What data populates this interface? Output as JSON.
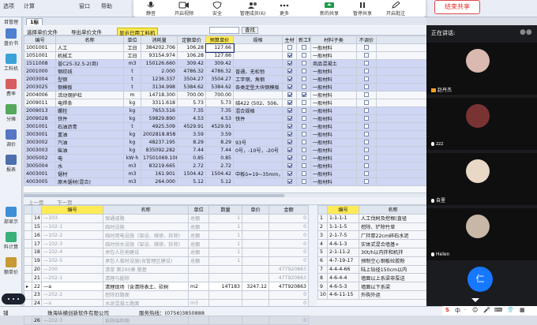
{
  "app_menu": [
    "选项",
    "计算",
    "窗口",
    "帮助"
  ],
  "meeting_toolbar": {
    "buttons": [
      {
        "label": "静音",
        "icon": "mic-icon"
      },
      {
        "label": "开启视频",
        "icon": "video-icon"
      },
      {
        "label": "安全",
        "icon": "shield-icon"
      },
      {
        "label": "管理成员(6)",
        "icon": "members-icon"
      },
      {
        "label": "更多",
        "icon": "more-icon"
      },
      {
        "label": "新的共享",
        "icon": "share-icon"
      },
      {
        "label": "暂停共享",
        "icon": "pause-icon"
      },
      {
        "label": "开启批注",
        "icon": "annotate-icon"
      }
    ],
    "end_share": "结束共享"
  },
  "sidebar": {
    "items": [
      {
        "label": "目管理",
        "icon": "project-icon"
      },
      {
        "label": "盘价书",
        "icon": "book-icon"
      },
      {
        "label": "工料机",
        "icon": "labor-icon"
      },
      {
        "label": "费率",
        "icon": "rate-icon"
      },
      {
        "label": "分摊",
        "icon": "split-icon"
      },
      {
        "label": "调价",
        "icon": "price-icon"
      },
      {
        "label": "报表",
        "icon": "report-icon"
      },
      {
        "label": "部显示",
        "icon": "display-icon"
      },
      {
        "label": "料计算",
        "icon": "calc-icon"
      },
      {
        "label": "额单价",
        "icon": "unit-price-icon"
      }
    ]
  },
  "main": {
    "tab": "1标",
    "toolbar": {
      "select_unit": "选择单价文件",
      "export_unit": "导出单价文件",
      "filter": "显示已用工料机",
      "search": "查找"
    },
    "upper_columns": [
      "编号",
      "名称",
      "单位",
      "消耗量",
      "定额单价",
      "预算单价",
      "规格",
      "主材",
      "新工料",
      "材料子类",
      "不调价"
    ],
    "upper_rows": [
      {
        "code": "1001001",
        "name": "人工",
        "unit": "工日",
        "qty": "384202.706",
        "quota": "106.28",
        "budget": "127.66",
        "spec": "",
        "main": false,
        "newm": false,
        "sub": "一般材料",
        "nadj": false,
        "sel": false
      },
      {
        "code": "1051001",
        "name": "机械工",
        "unit": "工日",
        "qty": "93154.974",
        "quota": "106.28",
        "budget": "127.66",
        "spec": "",
        "main": true,
        "newm": false,
        "sub": "一般材料",
        "nadj": false,
        "sel": false
      },
      {
        "code": "1511008",
        "name": "普C25-32.5-2(商)",
        "unit": "m3",
        "qty": "150126.660",
        "quota": "309.42",
        "budget": "309.42",
        "spec": "",
        "main": true,
        "newm": false,
        "sub": "商品混凝土",
        "nadj": false,
        "sel": true
      },
      {
        "code": "2001000",
        "name": "钢绞线",
        "unit": "t",
        "qty": "2.000",
        "quota": "4786.32",
        "budget": "4786.32",
        "spec": "普通，无松弛",
        "main": true,
        "newm": false,
        "sub": "一般材料",
        "nadj": false,
        "sel": true
      },
      {
        "code": "2003004",
        "name": "型钢",
        "unit": "t",
        "qty": "1236.337",
        "quota": "3504.27",
        "budget": "3504.27",
        "spec": "工字钢，角钢",
        "main": true,
        "newm": false,
        "sub": "一般材料",
        "nadj": false,
        "sel": true
      },
      {
        "code": "2003025",
        "name": "钢模板",
        "unit": "t",
        "qty": "3134.998",
        "quota": "5384.62",
        "budget": "5384.62",
        "spec": "各类定型大块钢模板",
        "main": true,
        "newm": false,
        "sub": "一般材料",
        "nadj": false,
        "sel": true
      },
      {
        "code": "2004006",
        "name": "活动钢护栏",
        "unit": "m",
        "qty": "14718.300",
        "quota": "700.00",
        "budget": "700.00",
        "spec": "",
        "main": true,
        "newm": true,
        "sub": "一般材料",
        "nadj": false,
        "sel": false
      },
      {
        "code": "2009011",
        "name": "电焊条",
        "unit": "kg",
        "qty": "3311.618",
        "quota": "5.73",
        "budget": "5.73",
        "spec": "结422 (502、506、5",
        "main": true,
        "newm": false,
        "sub": "一般材料",
        "nadj": false,
        "sel": false
      },
      {
        "code": "2009013",
        "name": "螺栓",
        "unit": "kg",
        "qty": "7653.516",
        "quota": "7.35",
        "budget": "7.35",
        "spec": "混合规格",
        "main": true,
        "newm": false,
        "sub": "一般材料",
        "nadj": false,
        "sel": true
      },
      {
        "code": "2009028",
        "name": "铁件",
        "unit": "kg",
        "qty": "59829.890",
        "quota": "4.53",
        "budget": "4.53",
        "spec": "铁件",
        "main": true,
        "newm": false,
        "sub": "一般材料",
        "nadj": false,
        "sel": true
      },
      {
        "code": "3001001",
        "name": "石油沥青",
        "unit": "t",
        "qty": "4925.509",
        "quota": "4529.91",
        "budget": "4529.91",
        "spec": "",
        "main": true,
        "newm": false,
        "sub": "一般材料",
        "nadj": false,
        "sel": true
      },
      {
        "code": "3003001",
        "name": "重油",
        "unit": "kg",
        "qty": "2002818.858",
        "quota": "3.59",
        "budget": "3.59",
        "spec": "",
        "main": true,
        "newm": false,
        "sub": "一般材料",
        "nadj": false,
        "sel": true
      },
      {
        "code": "3003002",
        "name": "汽油",
        "unit": "kg",
        "qty": "48237.195",
        "quota": "8.29",
        "budget": "8.29",
        "spec": "93号",
        "main": true,
        "newm": false,
        "sub": "一般材料",
        "nadj": false,
        "sel": true
      },
      {
        "code": "3003003",
        "name": "柴油",
        "unit": "kg",
        "qty": "835092.282",
        "quota": "7.44",
        "budget": "7.44",
        "spec": "0号，-10号，-20号",
        "main": true,
        "newm": false,
        "sub": "一般材料",
        "nadj": false,
        "sel": true
      },
      {
        "code": "3005002",
        "name": "电",
        "unit": "kW·h",
        "qty": "17501069.108",
        "quota": "0.85",
        "budget": "0.85",
        "spec": "",
        "main": true,
        "newm": false,
        "sub": "一般材料",
        "nadj": false,
        "sel": true
      },
      {
        "code": "3005004",
        "name": "水",
        "unit": "m3",
        "qty": "83219.665",
        "quota": "2.72",
        "budget": "2.72",
        "spec": "",
        "main": true,
        "newm": false,
        "sub": "一般材料",
        "nadj": false,
        "sel": true
      },
      {
        "code": "4003001",
        "name": "锯材",
        "unit": "m3",
        "qty": "161.901",
        "quota": "1504.42",
        "budget": "1504.42",
        "spec": "中板δ=19~35mm，",
        "main": true,
        "newm": false,
        "sub": "一般材料",
        "nadj": false,
        "sel": true
      },
      {
        "code": "4003005",
        "name": "原木锯材(混合)",
        "unit": "m3",
        "qty": "264.000",
        "quota": "5.12",
        "budget": "5.12",
        "spec": "",
        "main": true,
        "newm": false,
        "sub": "一般材料",
        "nadj": false,
        "sel": true
      }
    ],
    "lower_nav": [
      "上一页",
      "下一页"
    ],
    "lower_left_columns": [
      "",
      "编号",
      "名称",
      "单位",
      "数量",
      "单价",
      "金额"
    ],
    "lower_left_rows": [
      {
        "no": "14",
        "code": "—103",
        "name": "保通道路",
        "unit": "总额",
        "qty": "1",
        "price": "",
        "amount": "0",
        "grey": true
      },
      {
        "no": "15",
        "code": "—102-1",
        "name": "临时设施",
        "unit": "总额",
        "qty": "1",
        "price": "",
        "amount": "0",
        "grey": true
      },
      {
        "no": "16",
        "code": "—102-2",
        "name": "临时用电设施（架设、维修、拆除）",
        "unit": "总额",
        "qty": "1",
        "price": "",
        "amount": "0",
        "grey": true
      },
      {
        "no": "17",
        "code": "—102-3",
        "name": "临时供水设施（架设、维修、拆除）",
        "unit": "总额",
        "qty": "1",
        "price": "",
        "amount": "0",
        "grey": true
      },
      {
        "no": "18",
        "code": "—102-4",
        "name": "承包人驻地建设",
        "unit": "总额",
        "qty": "1",
        "price": "",
        "amount": "0",
        "grey": true
      },
      {
        "no": "19",
        "code": "—102-5",
        "name": "承包人临时设施(含管理区建设)",
        "unit": "总额",
        "qty": "1",
        "price": "",
        "amount": "0",
        "grey": true
      },
      {
        "no": "20",
        "code": "—200",
        "name": "清单 第200章 路基",
        "unit": "",
        "qty": "",
        "price": "",
        "amount": "47T920863",
        "grey": true
      },
      {
        "no": "21",
        "code": "—202-1",
        "name": "清理与掘除",
        "unit": "",
        "qty": "",
        "price": "",
        "amount": "47T920863",
        "grey": true
      },
      {
        "no": "22",
        "code": "—a",
        "name": "清理现场（含清除表土、砍树",
        "unit": "m2",
        "qty": "14T183",
        "price": "3247.12",
        "amount": "47T920863",
        "grey": false,
        "sel": true
      },
      {
        "no": "23",
        "code": "—202-2",
        "name": "挖除旧路面",
        "unit": "",
        "qty": "",
        "price": "",
        "amount": "0",
        "grey": true
      },
      {
        "no": "24",
        "code": "—a",
        "name": "水泥混凝土路面",
        "unit": "m3",
        "qty": "",
        "price": "",
        "amount": "0",
        "grey": true
      },
      {
        "no": "25",
        "code": "—b",
        "name": "沥青混凝土路面",
        "unit": "m3",
        "qty": "",
        "price": "",
        "amount": "0",
        "grey": true
      },
      {
        "no": "26",
        "code": "—202-3",
        "name": "拆除结构物",
        "unit": "",
        "qty": "",
        "price": "",
        "amount": "0",
        "grey": true
      }
    ],
    "lower_right_columns": [
      "",
      "编号",
      "名称"
    ],
    "lower_right_rows": [
      {
        "no": "1",
        "code": "1-1-1-1",
        "name": "人工伐树及挖根(直径"
      },
      {
        "no": "2",
        "code": "1-1-1-5",
        "name": "挖除、铲除竹草"
      },
      {
        "no": "3",
        "code": "2-1-7-5",
        "name": "厂拌厚22cm碎石水泥"
      },
      {
        "no": "4",
        "code": "4-6-1-3",
        "name": "实体式混合墙基+"
      },
      {
        "no": "5",
        "code": "2-1-11-2",
        "name": "30t/h以内拌和机拌"
      },
      {
        "no": "6",
        "code": "4-7-19-17",
        "name": "预制空心钢板砼胶粉"
      },
      {
        "no": "7",
        "code": "4-4-4-66",
        "name": "陆上钻径150cm以内"
      },
      {
        "no": "8",
        "code": "4-6-4-4",
        "name": "墙面以上系梁非泵送"
      },
      {
        "no": "9",
        "code": "4-6-5-3",
        "name": "墙面以下系梁"
      },
      {
        "no": "10",
        "code": "4-6-11-15",
        "name": "外购外运"
      }
    ]
  },
  "status_bar": {
    "left": "铺",
    "company": "珠海纵横创新软件有限公司",
    "phone": "服务热线：(0756)3850888"
  },
  "speaker_panel": {
    "title": "正在讲话:",
    "participants": [
      {
        "name": "赵丹杰",
        "avatar_color": "#d9b9b0"
      },
      {
        "name": "zzz",
        "avatar_color": "#7a3333"
      },
      {
        "name": "自里",
        "avatar_color": "#e9d8c6"
      },
      {
        "name": "Helen",
        "avatar_color": "#c8b6a6"
      }
    ],
    "self_avatar": "仁"
  },
  "ime_bar": [
    "S",
    "中",
    "·",
    "☺",
    "🎤",
    "⌨",
    "👕",
    "▦"
  ]
}
